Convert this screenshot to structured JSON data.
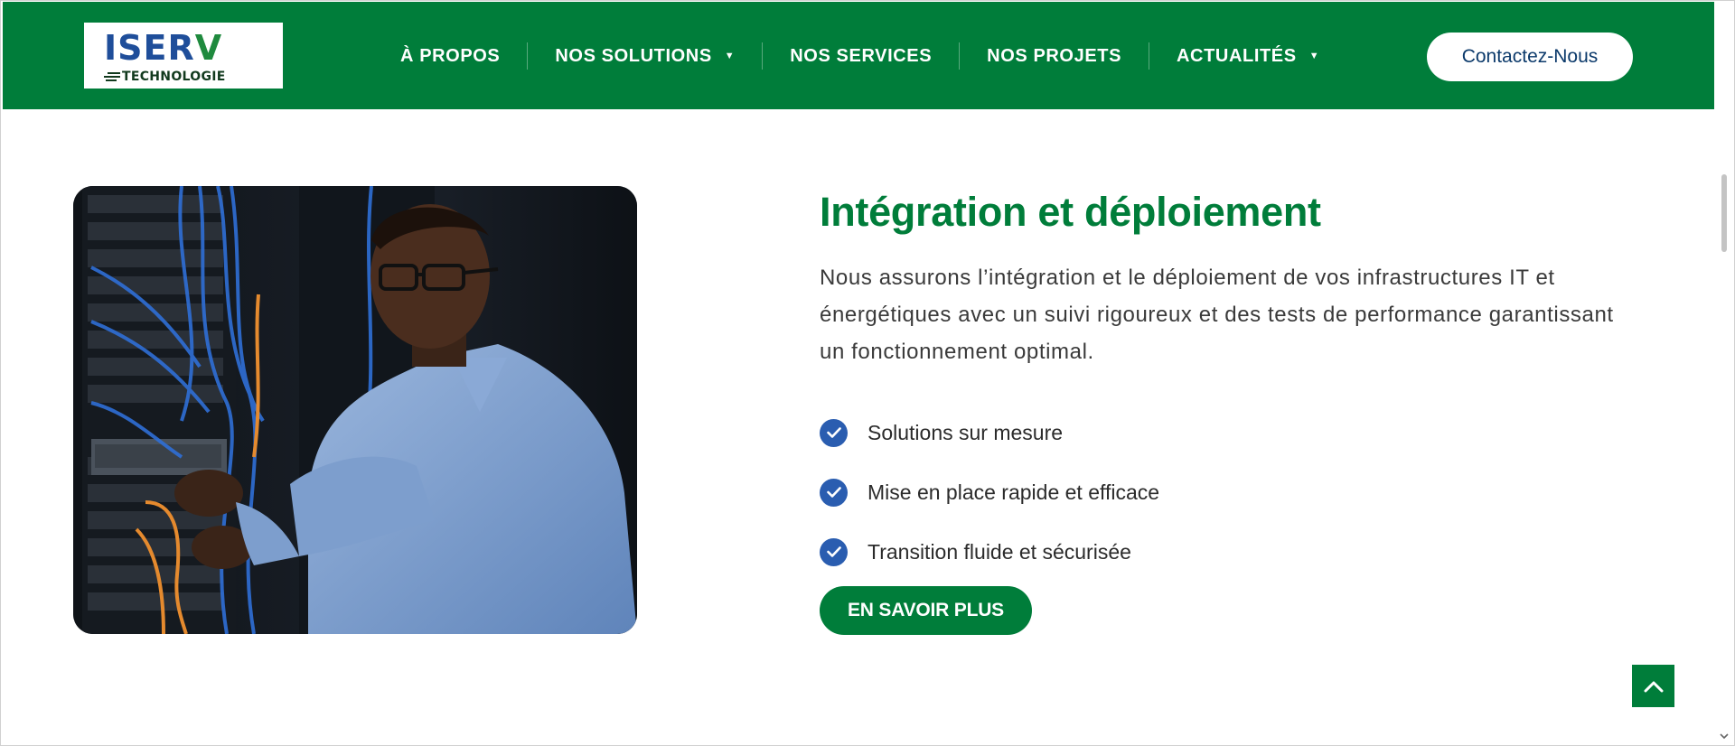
{
  "brand": {
    "logo_main": "ISER",
    "logo_main_v": "V",
    "logo_sub": "TECHNOLOGIE"
  },
  "nav": {
    "items": [
      {
        "label": "À PROPOS",
        "dropdown": false
      },
      {
        "label": "NOS SOLUTIONS",
        "dropdown": true
      },
      {
        "label": "NOS SERVICES",
        "dropdown": false
      },
      {
        "label": "NOS PROJETS",
        "dropdown": false
      },
      {
        "label": "ACTUALITÉS",
        "dropdown": true
      }
    ],
    "contact_label": "Contactez-Nous"
  },
  "section": {
    "title": "Intégration et déploiement",
    "description": "Nous assurons l’intégration et le déploiement de vos infrastructures IT et énergétiques avec un suivi rigoureux et des tests de performance garantissant un fonctionnement optimal.",
    "features": [
      "Solutions sur mesure",
      "Mise en place rapide et efficace",
      "Transition fluide et sécurisée"
    ],
    "cta_label": "EN SAVOIR PLUS"
  },
  "colors": {
    "brand_green": "#007d3a",
    "check_blue": "#2a5db0",
    "contact_text": "#0c3a6b"
  },
  "icons": {
    "check": "check-circle-icon",
    "caret": "caret-down-icon",
    "scroll_top": "chevron-up-icon"
  }
}
